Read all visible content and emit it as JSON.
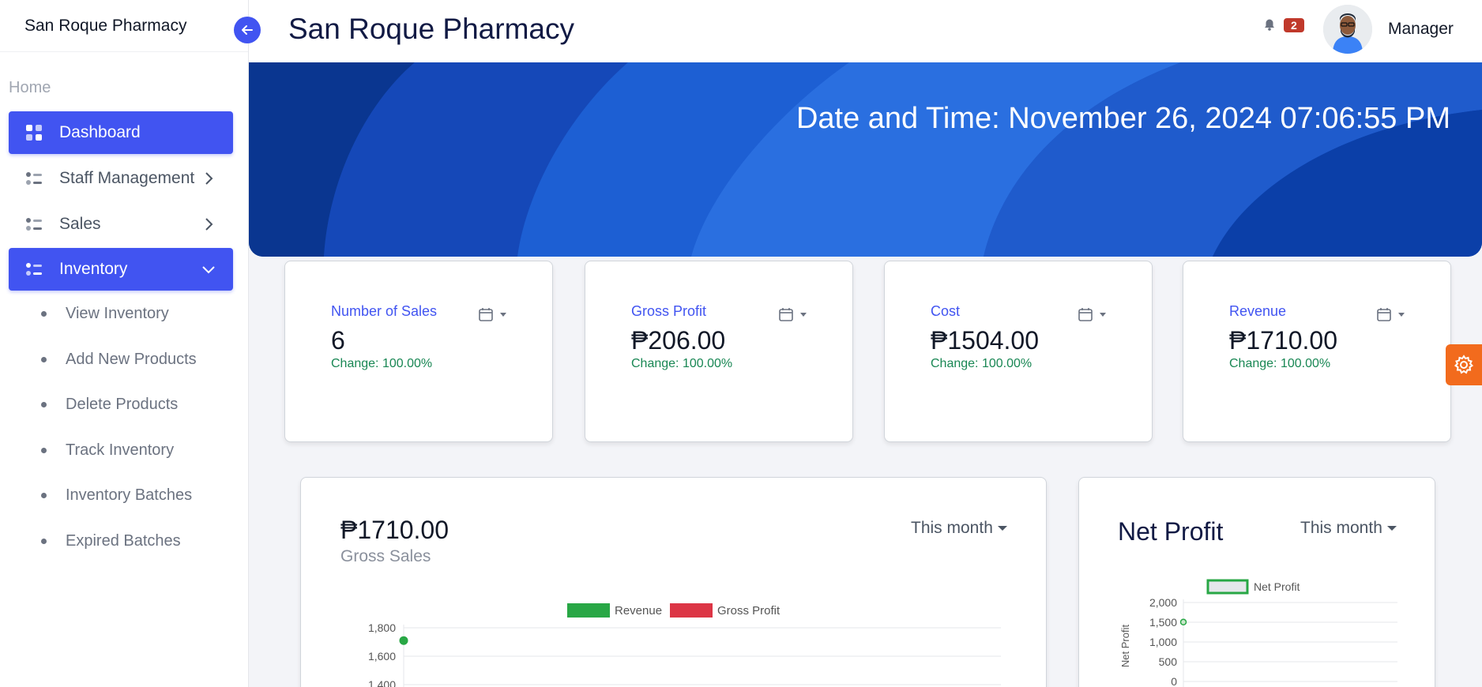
{
  "sidebar": {
    "brand": "San Roque Pharmacy",
    "section_label": "Home",
    "items": [
      {
        "label": "Dashboard"
      },
      {
        "label": "Staff Management"
      },
      {
        "label": "Sales"
      },
      {
        "label": "Inventory"
      }
    ],
    "inventory_sub": [
      {
        "label": "View Inventory"
      },
      {
        "label": "Add New Products"
      },
      {
        "label": "Delete Products"
      },
      {
        "label": "Track Inventory"
      },
      {
        "label": "Inventory Batches"
      },
      {
        "label": "Expired Batches"
      }
    ]
  },
  "header": {
    "title": "San Roque Pharmacy",
    "notification_count": "2",
    "user_name": "Manager"
  },
  "banner": {
    "datetime": "Date and Time: November 26, 2024 07:06:55 PM"
  },
  "stats": [
    {
      "label": "Number of Sales",
      "value": "6",
      "change": "Change: 100.00%"
    },
    {
      "label": "Gross Profit",
      "value": "₱206.00",
      "change": "Change: 100.00%"
    },
    {
      "label": "Cost",
      "value": "₱1504.00",
      "change": "Change: 100.00%"
    },
    {
      "label": "Revenue",
      "value": "₱1710.00",
      "change": "Change: 100.00%"
    }
  ],
  "gross_sales": {
    "value": "₱1710.00",
    "caption": "Gross Sales",
    "period": "This month"
  },
  "net_profit": {
    "title": "Net Profit",
    "period": "This month"
  },
  "colors": {
    "accent": "#4154f1",
    "revenue": "#28a745",
    "gross_profit": "#dc3545",
    "change_positive": "#198754"
  },
  "chart_data": [
    {
      "type": "line",
      "series": [
        {
          "name": "Revenue",
          "color": "#28a745",
          "values": [
            1710
          ]
        },
        {
          "name": "Gross Profit",
          "color": "#dc3545",
          "values": []
        }
      ],
      "y_ticks": [
        "1,800",
        "1,600",
        "1,400"
      ],
      "ylim": [
        1400,
        1800
      ]
    },
    {
      "type": "line",
      "series": [
        {
          "name": "Net Profit",
          "color": "#28a745",
          "values": [
            1504
          ]
        }
      ],
      "ylabel": "Net Profit",
      "y_ticks": [
        "2,000",
        "1,500",
        "1,000",
        "500",
        "0"
      ],
      "ylim": [
        0,
        2000
      ]
    }
  ]
}
